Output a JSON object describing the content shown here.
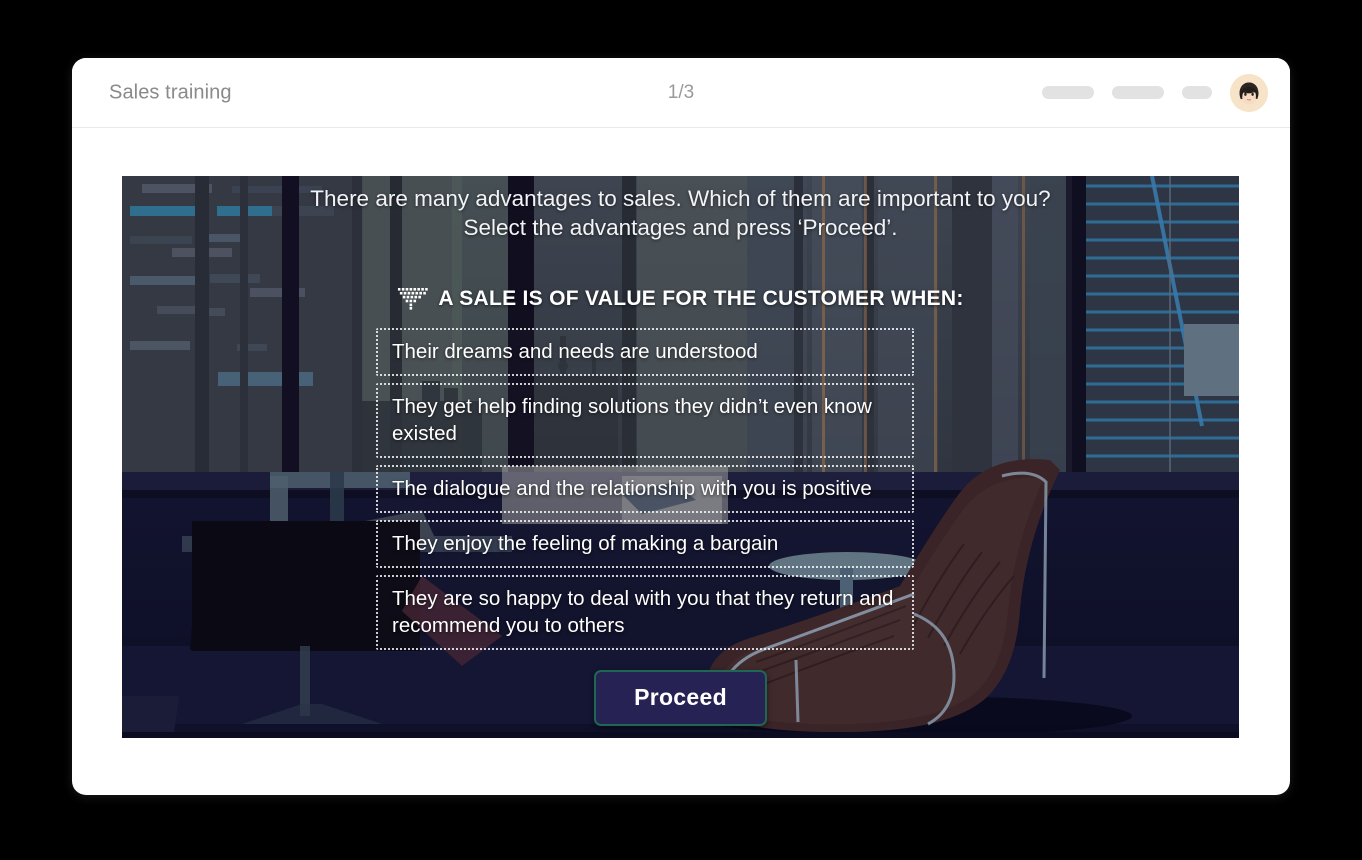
{
  "header": {
    "app_title": "Sales training",
    "page_counter": "1/3",
    "controls": [
      {
        "name": "placeholder-pill-1"
      },
      {
        "name": "placeholder-pill-2"
      },
      {
        "name": "placeholder-pill-3"
      }
    ],
    "avatar": {
      "icon": "user-avatar-woman",
      "background_color": "#f7e3c8"
    }
  },
  "scene": {
    "prompt_line_1": "There are many advantages to sales. Which of them are important to you?",
    "prompt_line_2": "Select the advantages and press ‘Proceed’.",
    "heading_icon": "funnel-icon",
    "heading": "A SALE IS OF VALUE FOR THE CUSTOMER WHEN:",
    "options": [
      {
        "label": "Their dreams and needs are understood",
        "selected": false
      },
      {
        "label": "They get help finding solutions they didn’t even know existed",
        "selected": false
      },
      {
        "label": "The dialogue and the relationship with you is positive",
        "selected": false
      },
      {
        "label": "They enjoy the feeling of making a bargain",
        "selected": false
      },
      {
        "label": "They are so happy to deal with you that they return and recommend you to others",
        "selected": false
      }
    ],
    "proceed_label": "Proceed"
  },
  "colors": {
    "page_background": "#000000",
    "card_background": "#ffffff",
    "title_text": "#8a8a8a",
    "counter_text": "#9a9a9a",
    "pill": "#e2e2e2",
    "scene_dark": "#101128",
    "option_text": "#ffffff",
    "proceed_fill": "#262253",
    "proceed_border": "#1f6654"
  }
}
